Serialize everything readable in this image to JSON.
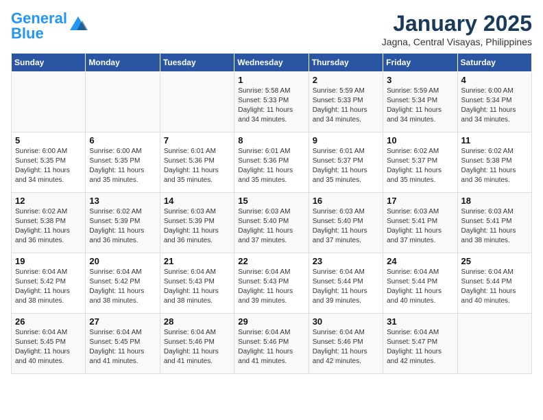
{
  "header": {
    "logo_line1": "General",
    "logo_line2": "Blue",
    "title": "January 2025",
    "subtitle": "Jagna, Central Visayas, Philippines"
  },
  "weekdays": [
    "Sunday",
    "Monday",
    "Tuesday",
    "Wednesday",
    "Thursday",
    "Friday",
    "Saturday"
  ],
  "weeks": [
    [
      {
        "day": "",
        "info": ""
      },
      {
        "day": "",
        "info": ""
      },
      {
        "day": "",
        "info": ""
      },
      {
        "day": "1",
        "info": "Sunrise: 5:58 AM\nSunset: 5:33 PM\nDaylight: 11 hours\nand 34 minutes."
      },
      {
        "day": "2",
        "info": "Sunrise: 5:59 AM\nSunset: 5:33 PM\nDaylight: 11 hours\nand 34 minutes."
      },
      {
        "day": "3",
        "info": "Sunrise: 5:59 AM\nSunset: 5:34 PM\nDaylight: 11 hours\nand 34 minutes."
      },
      {
        "day": "4",
        "info": "Sunrise: 6:00 AM\nSunset: 5:34 PM\nDaylight: 11 hours\nand 34 minutes."
      }
    ],
    [
      {
        "day": "5",
        "info": "Sunrise: 6:00 AM\nSunset: 5:35 PM\nDaylight: 11 hours\nand 34 minutes."
      },
      {
        "day": "6",
        "info": "Sunrise: 6:00 AM\nSunset: 5:35 PM\nDaylight: 11 hours\nand 35 minutes."
      },
      {
        "day": "7",
        "info": "Sunrise: 6:01 AM\nSunset: 5:36 PM\nDaylight: 11 hours\nand 35 minutes."
      },
      {
        "day": "8",
        "info": "Sunrise: 6:01 AM\nSunset: 5:36 PM\nDaylight: 11 hours\nand 35 minutes."
      },
      {
        "day": "9",
        "info": "Sunrise: 6:01 AM\nSunset: 5:37 PM\nDaylight: 11 hours\nand 35 minutes."
      },
      {
        "day": "10",
        "info": "Sunrise: 6:02 AM\nSunset: 5:37 PM\nDaylight: 11 hours\nand 35 minutes."
      },
      {
        "day": "11",
        "info": "Sunrise: 6:02 AM\nSunset: 5:38 PM\nDaylight: 11 hours\nand 36 minutes."
      }
    ],
    [
      {
        "day": "12",
        "info": "Sunrise: 6:02 AM\nSunset: 5:38 PM\nDaylight: 11 hours\nand 36 minutes."
      },
      {
        "day": "13",
        "info": "Sunrise: 6:02 AM\nSunset: 5:39 PM\nDaylight: 11 hours\nand 36 minutes."
      },
      {
        "day": "14",
        "info": "Sunrise: 6:03 AM\nSunset: 5:39 PM\nDaylight: 11 hours\nand 36 minutes."
      },
      {
        "day": "15",
        "info": "Sunrise: 6:03 AM\nSunset: 5:40 PM\nDaylight: 11 hours\nand 37 minutes."
      },
      {
        "day": "16",
        "info": "Sunrise: 6:03 AM\nSunset: 5:40 PM\nDaylight: 11 hours\nand 37 minutes."
      },
      {
        "day": "17",
        "info": "Sunrise: 6:03 AM\nSunset: 5:41 PM\nDaylight: 11 hours\nand 37 minutes."
      },
      {
        "day": "18",
        "info": "Sunrise: 6:03 AM\nSunset: 5:41 PM\nDaylight: 11 hours\nand 38 minutes."
      }
    ],
    [
      {
        "day": "19",
        "info": "Sunrise: 6:04 AM\nSunset: 5:42 PM\nDaylight: 11 hours\nand 38 minutes."
      },
      {
        "day": "20",
        "info": "Sunrise: 6:04 AM\nSunset: 5:42 PM\nDaylight: 11 hours\nand 38 minutes."
      },
      {
        "day": "21",
        "info": "Sunrise: 6:04 AM\nSunset: 5:43 PM\nDaylight: 11 hours\nand 38 minutes."
      },
      {
        "day": "22",
        "info": "Sunrise: 6:04 AM\nSunset: 5:43 PM\nDaylight: 11 hours\nand 39 minutes."
      },
      {
        "day": "23",
        "info": "Sunrise: 6:04 AM\nSunset: 5:44 PM\nDaylight: 11 hours\nand 39 minutes."
      },
      {
        "day": "24",
        "info": "Sunrise: 6:04 AM\nSunset: 5:44 PM\nDaylight: 11 hours\nand 40 minutes."
      },
      {
        "day": "25",
        "info": "Sunrise: 6:04 AM\nSunset: 5:44 PM\nDaylight: 11 hours\nand 40 minutes."
      }
    ],
    [
      {
        "day": "26",
        "info": "Sunrise: 6:04 AM\nSunset: 5:45 PM\nDaylight: 11 hours\nand 40 minutes."
      },
      {
        "day": "27",
        "info": "Sunrise: 6:04 AM\nSunset: 5:45 PM\nDaylight: 11 hours\nand 41 minutes."
      },
      {
        "day": "28",
        "info": "Sunrise: 6:04 AM\nSunset: 5:46 PM\nDaylight: 11 hours\nand 41 minutes."
      },
      {
        "day": "29",
        "info": "Sunrise: 6:04 AM\nSunset: 5:46 PM\nDaylight: 11 hours\nand 41 minutes."
      },
      {
        "day": "30",
        "info": "Sunrise: 6:04 AM\nSunset: 5:46 PM\nDaylight: 11 hours\nand 42 minutes."
      },
      {
        "day": "31",
        "info": "Sunrise: 6:04 AM\nSunset: 5:47 PM\nDaylight: 11 hours\nand 42 minutes."
      },
      {
        "day": "",
        "info": ""
      }
    ]
  ]
}
